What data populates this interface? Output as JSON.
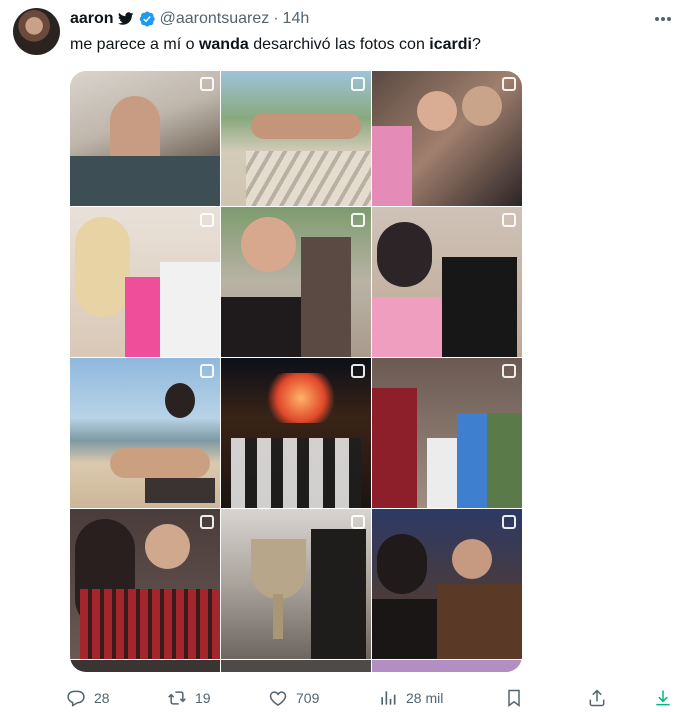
{
  "tweet": {
    "display_name": "aaron",
    "handle": "@aarontsuarez",
    "separator": "·",
    "time": "14h",
    "text_parts": [
      "me parece a mí o ",
      "wanda",
      " desarchivó las fotos con ",
      "icardi",
      "?"
    ]
  },
  "actions": {
    "replies": "28",
    "retweets": "19",
    "likes": "709",
    "views": "28 mil"
  },
  "colors": {
    "text_primary": "#0f1419",
    "text_secondary": "#536471",
    "verified_blue": "#1d9bf0",
    "download_green": "#00ba7c"
  },
  "icons": {
    "bird": "twitter-bird-icon",
    "verified": "verified-badge-icon",
    "more": "more-dots-icon",
    "reply": "reply-icon",
    "retweet": "retweet-icon",
    "like": "heart-icon",
    "views": "views-chart-icon",
    "bookmark": "bookmark-icon",
    "share": "share-icon",
    "download": "download-icon"
  }
}
